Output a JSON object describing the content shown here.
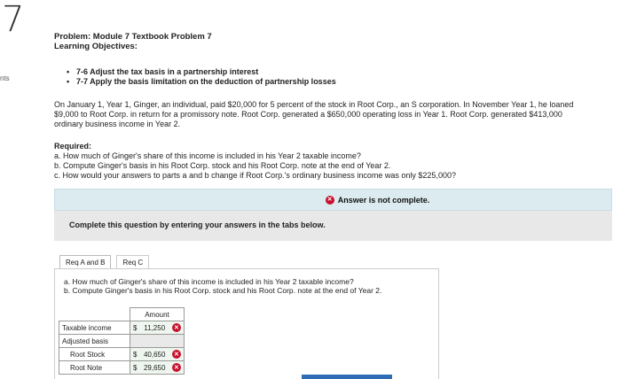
{
  "question_number": "7",
  "side_label": "nts",
  "problem_title": "Problem: Module 7 Textbook Problem 7",
  "objectives_label": "Learning Objectives:",
  "objectives": [
    "7-6 Adjust the tax basis in a partnership interest",
    "7-7 Apply the basis limitation on the deduction of partnership losses"
  ],
  "scenario": "On January 1, Year 1, Ginger, an individual, paid $20,000 for 5 percent of the stock in Root Corp., an S corporation. In November Year 1, he loaned $9,000 to Root Corp. in return for a promissory note. Root Corp. generated a $650,000 operating loss in Year 1. Root Corp. generated $413,000 ordinary business income in Year 2.",
  "required": {
    "header": "Required:",
    "items": [
      "a. How much of Ginger's share of this income is included in his Year 2 taxable income?",
      "b. Compute Ginger's basis in his Root Corp. stock and his Root Corp. note at the end of Year 2.",
      "c. How would your answers to parts a and b change if Root Corp.'s ordinary business income was only $225,000?"
    ]
  },
  "answer_status": "Answer is not complete.",
  "instruction": "Complete this question by entering your answers in the tabs below.",
  "tabs": [
    "Req A and B",
    "Req C"
  ],
  "panel_questions": [
    "a. How much of Ginger's share of this income is included in his Year 2 taxable income?",
    "b. Compute Ginger's basis in his Root Corp. stock and his Root Corp. note at the end of Year 2."
  ],
  "table": {
    "header": "Amount",
    "rows": [
      {
        "label": "Taxable income",
        "currency": "$",
        "value": "11,250",
        "status": "incorrect"
      },
      {
        "label": "Adjusted basis",
        "currency": "",
        "value": "",
        "status": ""
      },
      {
        "label": "Root Stock",
        "currency": "$",
        "value": "40,650",
        "status": "incorrect"
      },
      {
        "label": "Root Note",
        "currency": "$",
        "value": "29,650",
        "status": "incorrect"
      }
    ]
  },
  "colors": {
    "error_red": "#c8102e",
    "answer_bar_bg": "#dcebef",
    "instruction_bg": "#e8e8e8",
    "accent_blue": "#2e6db6"
  }
}
